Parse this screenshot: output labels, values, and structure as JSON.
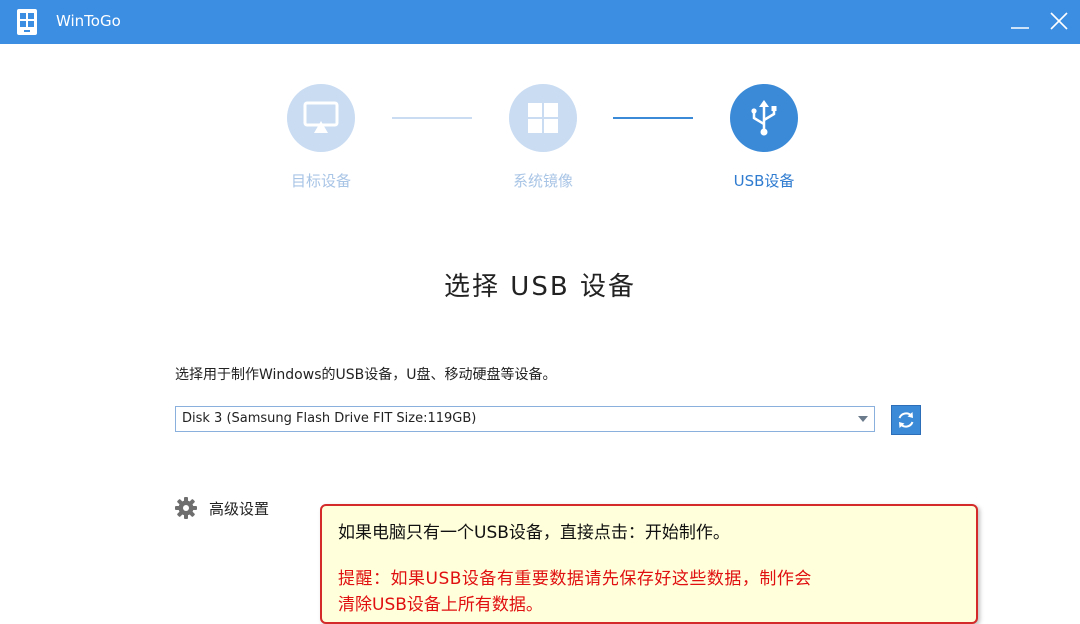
{
  "window": {
    "title": "WinToGo",
    "minimize_icon": "minimize-icon",
    "close_icon": "close-icon",
    "titlebar_color": "#3c8ee3"
  },
  "steps": [
    {
      "label": "目标设备",
      "icon": "monitor-icon",
      "state": "done"
    },
    {
      "label": "系统镜像",
      "icon": "windows-logo-icon",
      "state": "done"
    },
    {
      "label": "USB设备",
      "icon": "usb-icon",
      "state": "active"
    }
  ],
  "colors": {
    "accent": "#3a8ad8",
    "step_inactive": "#c9dcf2",
    "tooltip_border": "#d42a2a",
    "tooltip_bg": "#ffffdc",
    "warning_text": "#e01010"
  },
  "main": {
    "title": "选择 USB 设备",
    "description": "选择用于制作Windows的USB设备，U盘、移动硬盘等设备。",
    "device_select": {
      "selected": "Disk 3 (Samsung Flash Drive FIT  Size:119GB)"
    },
    "refresh_icon": "refresh-icon",
    "advanced_settings_label": "高级设置"
  },
  "tooltip": {
    "line1": "如果电脑只有一个USB设备，直接点击：开始制作。",
    "line2": "提醒：如果USB设备有重要数据请先保存好这些数据，制作会",
    "line3": "清除USB设备上所有数据。"
  }
}
